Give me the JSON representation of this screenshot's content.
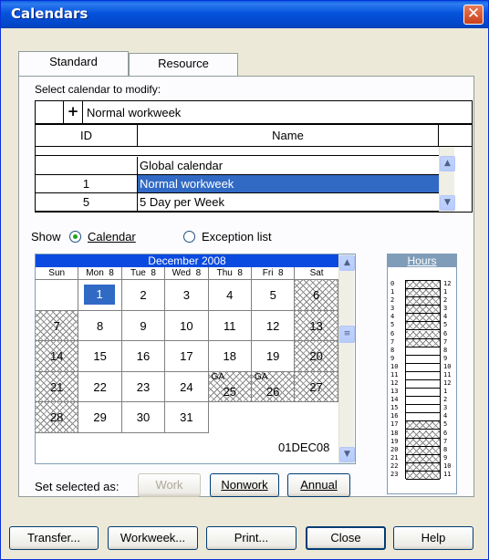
{
  "window": {
    "title": "Calendars",
    "close_glyph": "✕"
  },
  "tabs": [
    {
      "label": "Standard",
      "active": true
    },
    {
      "label": "Resource",
      "active": false
    }
  ],
  "select_label": "Select calendar to modify:",
  "current_calendar": {
    "expand_glyph": "+",
    "name": "Normal workweek"
  },
  "calendar_table": {
    "headers": [
      "ID",
      "Name"
    ],
    "rows": [
      {
        "id": "",
        "name": "Global calendar",
        "selected": false
      },
      {
        "id": "1",
        "name": "Normal workweek",
        "selected": true
      },
      {
        "id": "5",
        "name": "5 Day per Week",
        "selected": false
      }
    ]
  },
  "show": {
    "label": "Show",
    "options": [
      "Calendar",
      "Exception list"
    ],
    "selected": "Calendar"
  },
  "month_calendar": {
    "month_title": "December 2008",
    "weekdays": [
      "Sun",
      "Mon  8",
      "Tue  8",
      "Wed  8",
      "Thu  8",
      "Fri  8",
      "Sat"
    ],
    "weeks": [
      [
        "",
        "1",
        "2",
        "3",
        "4",
        "5",
        "6"
      ],
      [
        "7",
        "8",
        "9",
        "10",
        "11",
        "12",
        "13"
      ],
      [
        "14",
        "15",
        "16",
        "17",
        "18",
        "19",
        "20"
      ],
      [
        "21",
        "22",
        "23",
        "24",
        "25",
        "26",
        "27"
      ],
      [
        "28",
        "29",
        "30",
        "31",
        "",
        "",
        ""
      ]
    ],
    "cell_tags": {
      "25": "GA",
      "26": "GA"
    },
    "selected_day": "1",
    "nonwork_days": [
      "6",
      "7",
      "13",
      "14",
      "20",
      "21",
      "25",
      "26",
      "27",
      "28"
    ],
    "selected_date_readout": "01DEC08"
  },
  "hours": {
    "title": "Hours",
    "left_labels": [
      "0",
      "1",
      "2",
      "3",
      "4",
      "5",
      "6",
      "7",
      "8",
      "9",
      "10",
      "11",
      "12",
      "13",
      "14",
      "15",
      "16",
      "17",
      "18",
      "19",
      "20",
      "21",
      "22",
      "23"
    ],
    "right_labels": [
      "12",
      "1",
      "2",
      "3",
      "4",
      "5",
      "6",
      "7",
      "8",
      "9",
      "10",
      "11",
      "12",
      "1",
      "2",
      "3",
      "4",
      "5",
      "6",
      "7",
      "8",
      "9",
      "10",
      "11"
    ],
    "nonwork_hours": [
      0,
      1,
      2,
      3,
      4,
      5,
      6,
      7,
      17,
      18,
      19,
      20,
      21,
      22,
      23
    ]
  },
  "set_selected": {
    "label": "Set selected as:",
    "buttons": [
      "Work",
      "Nonwork",
      "Annual"
    ]
  },
  "footer_buttons": [
    "Transfer...",
    "Workweek...",
    "Print...",
    "Close",
    "Help"
  ],
  "colors": {
    "title_bar": "#0553dc",
    "selection": "#316ac5",
    "dialog_bg": "#ece9d8"
  }
}
